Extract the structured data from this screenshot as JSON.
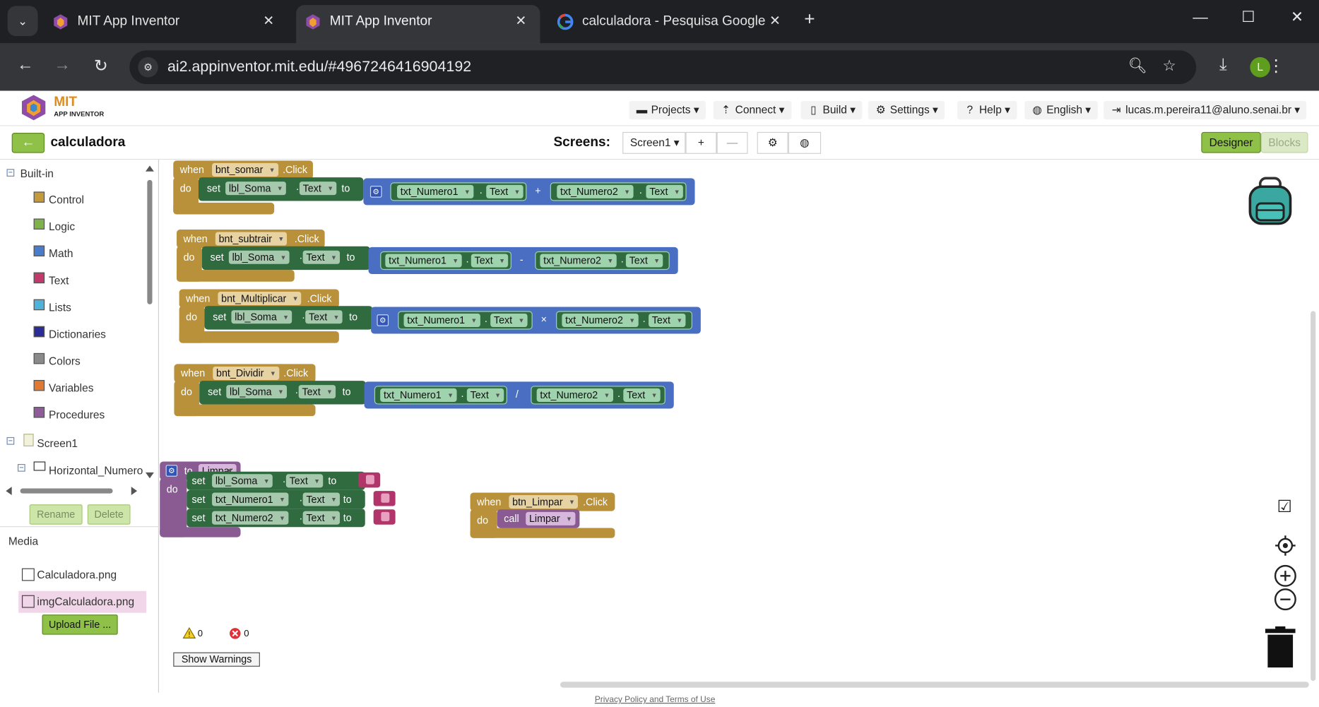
{
  "browser": {
    "tabs": [
      {
        "title": "MIT App Inventor",
        "active": false
      },
      {
        "title": "MIT App Inventor",
        "active": true
      },
      {
        "title": "calculadora - Pesquisa Google",
        "active": false
      }
    ],
    "url": "ai2.appinventor.mit.edu/#4967246416904192",
    "profile_initial": "L"
  },
  "header": {
    "logo_main": "MIT",
    "logo_sub": "APP INVENTOR",
    "menu": {
      "projects": "Projects",
      "connect": "Connect",
      "build": "Build",
      "settings": "Settings",
      "help": "Help",
      "language": "English",
      "user": "lucas.m.pereira11@aluno.senai.br"
    }
  },
  "projectbar": {
    "project_name": "calculadora",
    "screens_label": "Screens:",
    "current_screen": "Screen1",
    "designer_label": "Designer",
    "blocks_label": "Blocks"
  },
  "sidebar": {
    "builtin_label": "Built-in",
    "categories": [
      {
        "label": "Control",
        "color": "#c49a3c"
      },
      {
        "label": "Logic",
        "color": "#7fb24a"
      },
      {
        "label": "Math",
        "color": "#4a7ccc"
      },
      {
        "label": "Text",
        "color": "#c2396c"
      },
      {
        "label": "Lists",
        "color": "#4fb3d9"
      },
      {
        "label": "Dictionaries",
        "color": "#2c2c99"
      },
      {
        "label": "Colors",
        "color": "#8a8a8a"
      },
      {
        "label": "Variables",
        "color": "#e07a32"
      },
      {
        "label": "Procedures",
        "color": "#8e5c98"
      }
    ],
    "screen_node": "Screen1",
    "component_node": "Horizontal_Numero",
    "rename_label": "Rename",
    "delete_label": "Delete",
    "media_title": "Media",
    "media_files": [
      "Calculadora.png",
      "imgCalculadora.png"
    ],
    "upload_label": "Upload File ..."
  },
  "blocks": {
    "kw_when": "when",
    "kw_do": "do",
    "kw_set": "set",
    "kw_to": "to",
    "kw_call": "call",
    "kw_click": ".Click",
    "dot": ".",
    "prop_text": "Text",
    "label_soma": "lbl_Soma",
    "input1": "txt_Numero1",
    "input2": "txt_Numero2",
    "events": [
      {
        "button": "bnt_somar",
        "op": "+"
      },
      {
        "button": "bnt_subtrair",
        "op": "-"
      },
      {
        "button": "bnt_Multiplicar",
        "op": "×"
      },
      {
        "button": "bnt_Dividir",
        "op": "/"
      }
    ],
    "procedure": {
      "name": "Limpar"
    },
    "clear_event": {
      "button": "btn_Limpar"
    }
  },
  "warnings": {
    "warning_count": "0",
    "error_count": "0",
    "show_label": "Show Warnings"
  },
  "footer": {
    "privacy": "Privacy Policy and Terms of Use"
  }
}
